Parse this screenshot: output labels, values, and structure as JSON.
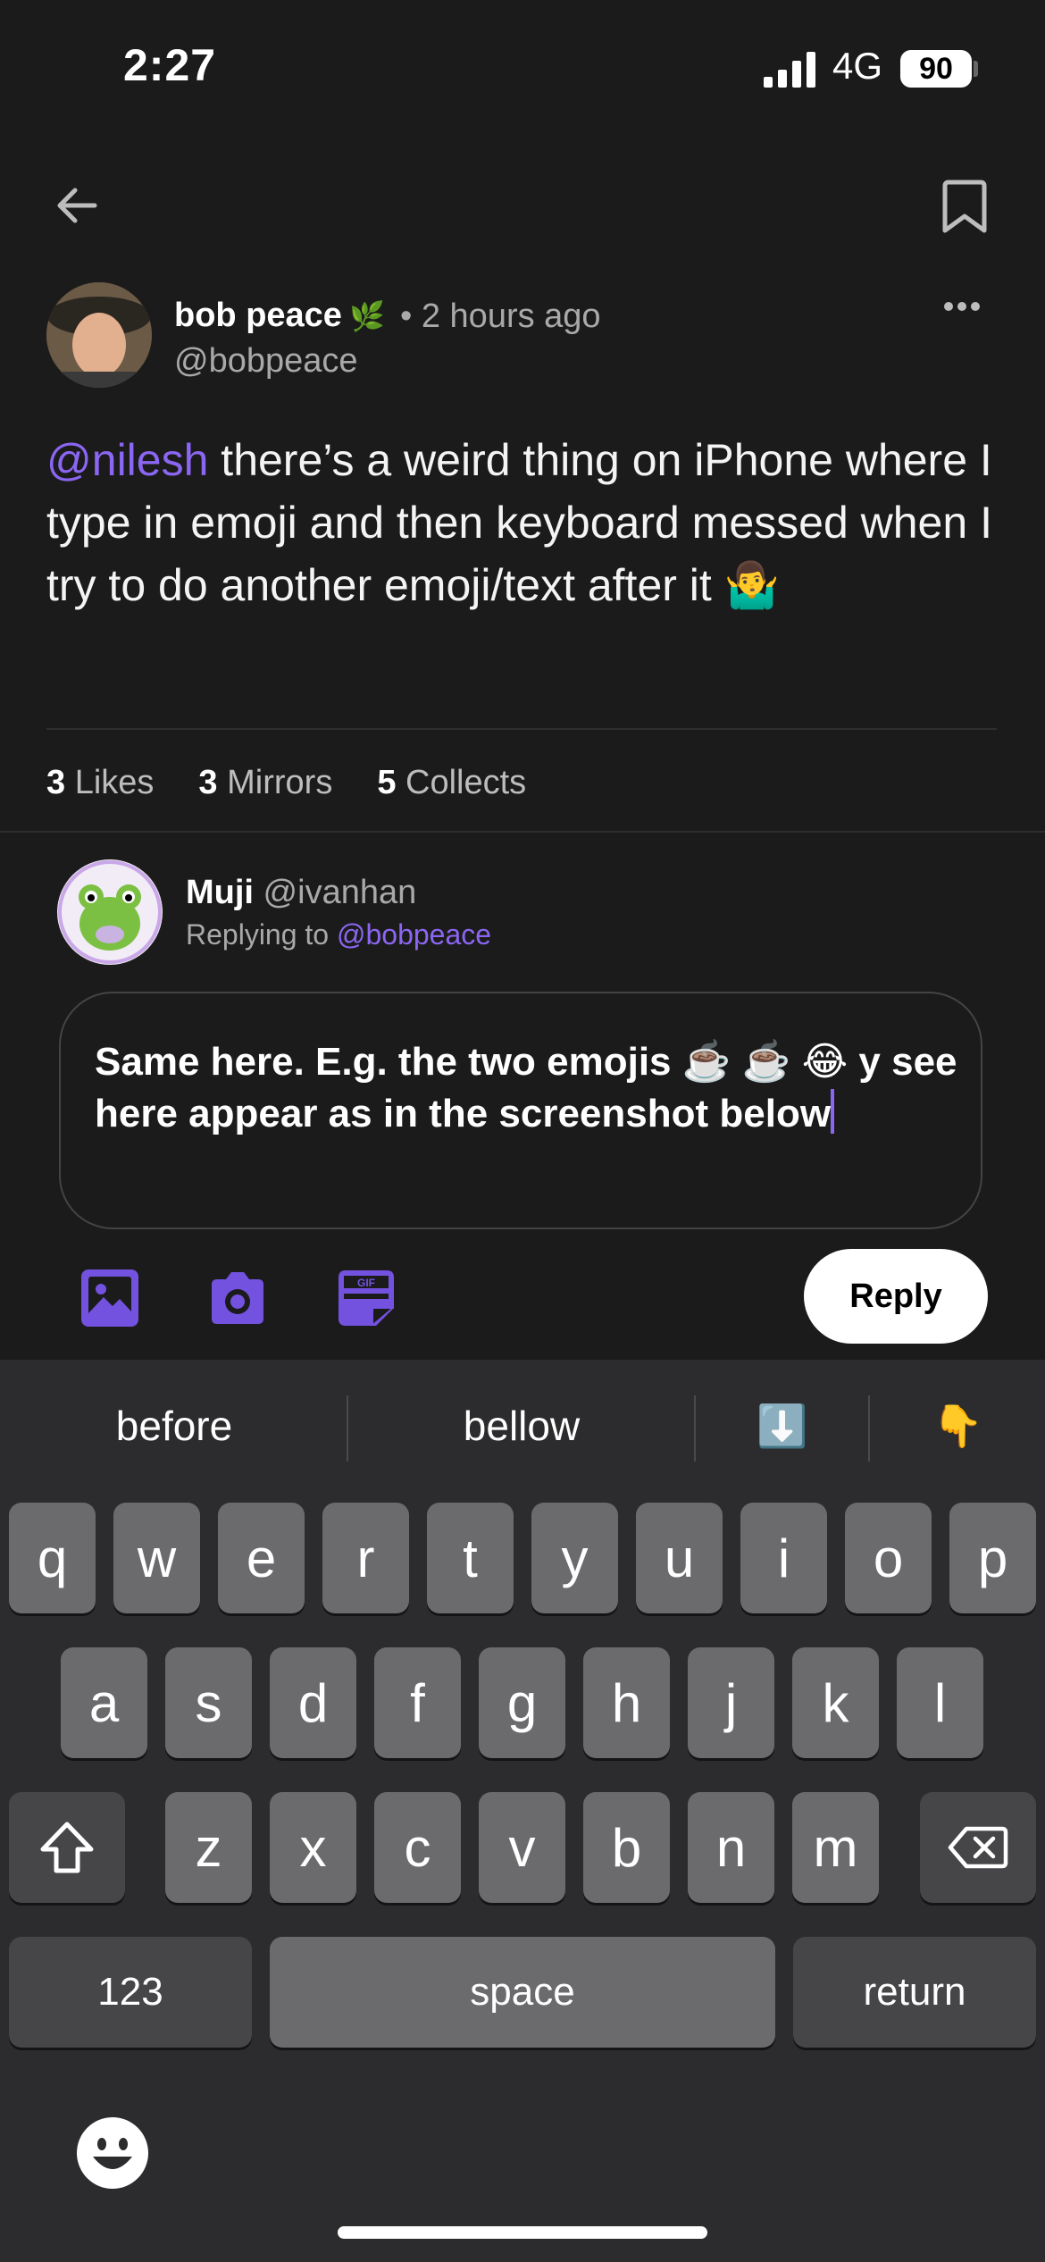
{
  "status": {
    "time": "2:27",
    "network": "4G",
    "battery": "90"
  },
  "post": {
    "author_name": "bob peace",
    "author_badge": "🌿",
    "time_ago": "• 2 hours ago",
    "handle": "@bobpeace",
    "mention": "@nilesh",
    "text": " there’s a weird thing on iPhone where I type in emoji and then keyboard messed when I try to do another emoji/text after it 🤷‍♂️",
    "stats": [
      {
        "count": "3",
        "label": "Likes"
      },
      {
        "count": "3",
        "label": "Mirrors"
      },
      {
        "count": "5",
        "label": "Collects"
      }
    ]
  },
  "reply": {
    "name": "Muji",
    "handle": "@ivanhan",
    "replying_prefix": "Replying to",
    "replying_to": "@bobpeace",
    "draft": "Same here. E.g. the two emojis ☕️ ☕️ 😂  y see here appear as in the screenshot below",
    "button": "Reply"
  },
  "keyboard": {
    "suggestions": [
      "before",
      "bellow",
      "⬇️",
      "👇"
    ],
    "row1": [
      "q",
      "w",
      "e",
      "r",
      "t",
      "y",
      "u",
      "i",
      "o",
      "p"
    ],
    "row2": [
      "a",
      "s",
      "d",
      "f",
      "g",
      "h",
      "j",
      "k",
      "l"
    ],
    "row3": [
      "z",
      "x",
      "c",
      "v",
      "b",
      "n",
      "m"
    ],
    "numbers": "123",
    "space": "space",
    "return": "return"
  },
  "colors": {
    "accent": "#8b66f2",
    "background": "#1b1b1b",
    "keyboard": "#2c2c2e"
  },
  "icons": [
    "back-arrow-icon",
    "bookmark-icon",
    "more-icon",
    "image-icon",
    "camera-icon",
    "gif-icon",
    "shift-icon",
    "delete-icon",
    "emoji-icon"
  ]
}
